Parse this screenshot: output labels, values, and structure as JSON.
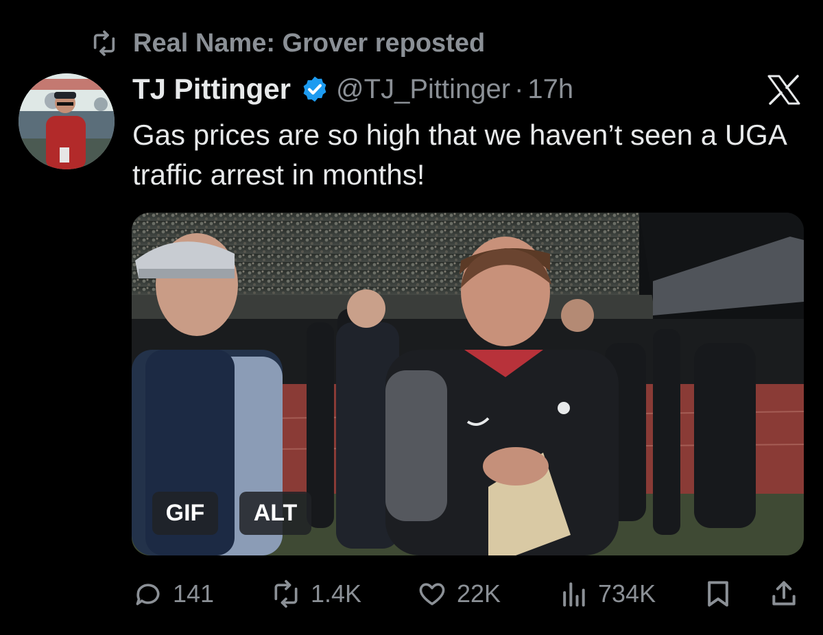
{
  "repost": {
    "icon": "repost-icon",
    "text": "Real Name: Grover reposted"
  },
  "tweet": {
    "author_name": "TJ Pittinger",
    "handle": "@TJ_Pittinger",
    "separator": "·",
    "time": "17h",
    "verified_icon": "verified-badge-icon",
    "platform_icon": "x-logo-icon",
    "text": "Gas prices are so high that we haven’t seen a UGA traffic arrest in months!"
  },
  "media": {
    "gif_label": "GIF",
    "alt_label": "ALT"
  },
  "actions": {
    "replies": "141",
    "reposts": "1.4K",
    "likes": "22K",
    "views": "734K"
  },
  "colors": {
    "background": "#000000",
    "text_primary": "#e7e9ea",
    "text_secondary": "#8b9096",
    "verified": "#1d9bf0"
  }
}
